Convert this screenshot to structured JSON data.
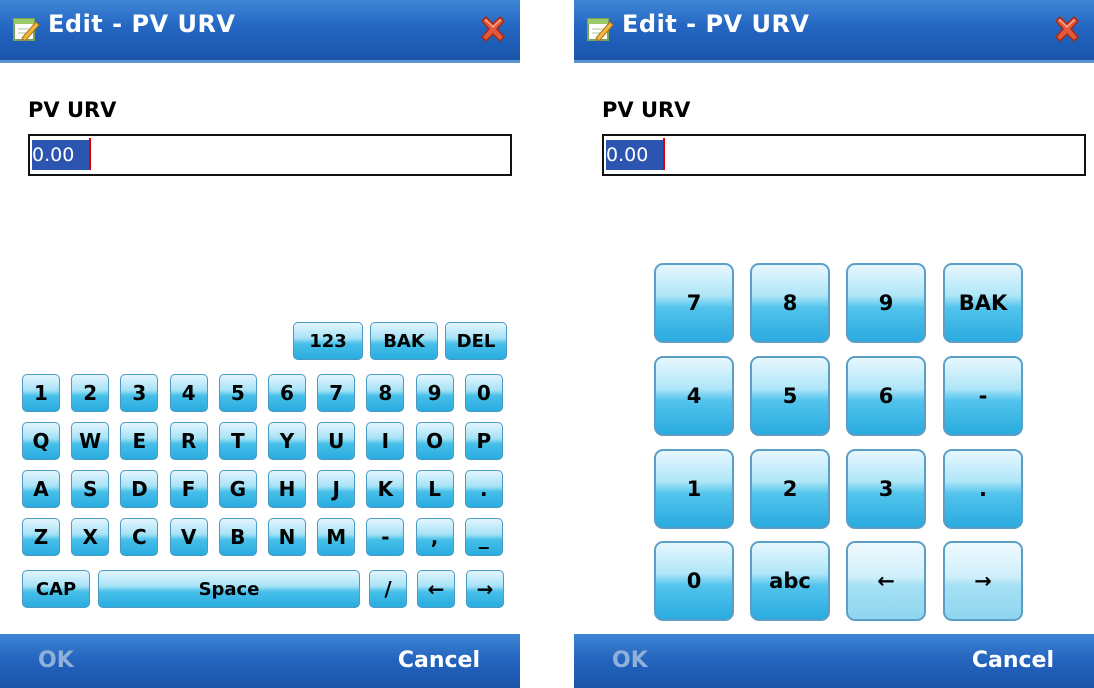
{
  "left": {
    "title": "Edit - PV URV",
    "field_label": "PV URV",
    "field_value": "0.00",
    "keyboard": {
      "top_row": [
        "123",
        "BAK",
        "DEL"
      ],
      "row1": [
        "1",
        "2",
        "3",
        "4",
        "5",
        "6",
        "7",
        "8",
        "9",
        "0"
      ],
      "row2": [
        "Q",
        "W",
        "E",
        "R",
        "T",
        "Y",
        "U",
        "I",
        "O",
        "P"
      ],
      "row3": [
        "A",
        "S",
        "D",
        "F",
        "G",
        "H",
        "J",
        "K",
        "L",
        "."
      ],
      "row4": [
        "Z",
        "X",
        "C",
        "V",
        "B",
        "N",
        "M",
        "-",
        ",",
        "_"
      ],
      "cap": "CAP",
      "space": "Space",
      "slash": "/",
      "left_arrow": "←",
      "right_arrow": "→"
    },
    "softkeys": {
      "ok": "OK",
      "cancel": "Cancel"
    }
  },
  "right": {
    "title": "Edit - PV URV",
    "field_label": "PV URV",
    "field_value": "0.00",
    "numpad": [
      [
        "7",
        "8",
        "9",
        "BAK"
      ],
      [
        "4",
        "5",
        "6",
        "-"
      ],
      [
        "1",
        "2",
        "3",
        "."
      ],
      [
        "0",
        "abc",
        "←",
        "→"
      ]
    ],
    "softkeys": {
      "ok": "OK",
      "cancel": "Cancel"
    }
  },
  "colors": {
    "titlebar": "#2466c2",
    "key_blue": "#29ace0",
    "selection": "#2b55b0",
    "caret": "#d80000",
    "ok_disabled": "#8fb0d8"
  },
  "icons": {
    "app": "edit-notepad-icon",
    "close": "close-x-icon"
  }
}
